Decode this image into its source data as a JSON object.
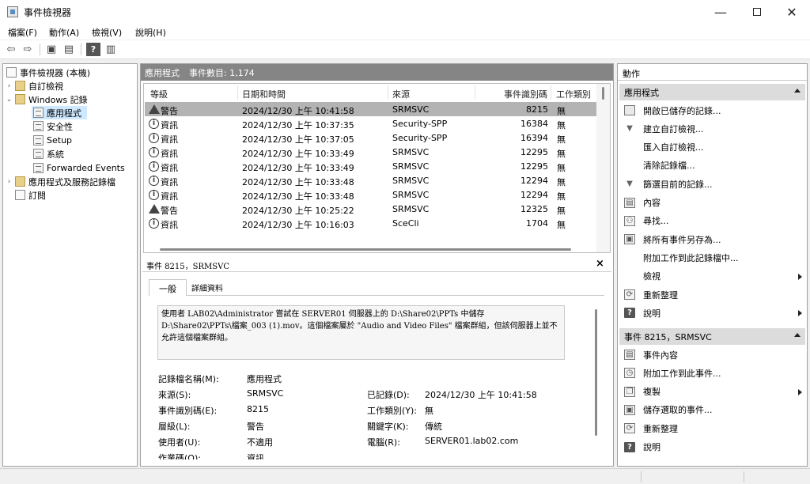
{
  "window": {
    "title": "事件檢視器"
  },
  "menu": [
    "檔案(F)",
    "動作(A)",
    "檢視(V)",
    "說明(H)"
  ],
  "tree": {
    "items": [
      {
        "label": "事件檢視器 (本機)",
        "icon": "event-viewer-icon"
      },
      {
        "label": "自訂檢視",
        "icon": "folder-icon"
      },
      {
        "label": "Windows 記錄",
        "icon": "folder-icon"
      },
      {
        "label": "應用程式",
        "icon": "log-icon"
      },
      {
        "label": "安全性",
        "icon": "log-icon"
      },
      {
        "label": "Setup",
        "icon": "log-icon"
      },
      {
        "label": "系統",
        "icon": "log-icon"
      },
      {
        "label": "Forwarded Events",
        "icon": "log-icon"
      },
      {
        "label": "應用程式及服務記錄檔",
        "icon": "folder-icon"
      },
      {
        "label": "訂閱",
        "icon": "subscription-icon"
      }
    ]
  },
  "list": {
    "title": "應用程式",
    "count_label": "事件數目: 1,174",
    "columns": [
      "等級",
      "日期和時間",
      "來源",
      "事件識別碼",
      "工作類別"
    ],
    "rows": [
      {
        "level": "警告",
        "icon": "warning-icon",
        "datetime": "2024/12/30 上午 10:41:58",
        "source": "SRMSVC",
        "id": "8215",
        "task": "無"
      },
      {
        "level": "資訊",
        "icon": "info-icon",
        "datetime": "2024/12/30 上午 10:37:35",
        "source": "Security-SPP",
        "id": "16384",
        "task": "無"
      },
      {
        "level": "資訊",
        "icon": "info-icon",
        "datetime": "2024/12/30 上午 10:37:05",
        "source": "Security-SPP",
        "id": "16394",
        "task": "無"
      },
      {
        "level": "資訊",
        "icon": "info-icon",
        "datetime": "2024/12/30 上午 10:33:49",
        "source": "SRMSVC",
        "id": "12295",
        "task": "無"
      },
      {
        "level": "資訊",
        "icon": "info-icon",
        "datetime": "2024/12/30 上午 10:33:49",
        "source": "SRMSVC",
        "id": "12295",
        "task": "無"
      },
      {
        "level": "資訊",
        "icon": "info-icon",
        "datetime": "2024/12/30 上午 10:33:48",
        "source": "SRMSVC",
        "id": "12294",
        "task": "無"
      },
      {
        "level": "資訊",
        "icon": "info-icon",
        "datetime": "2024/12/30 上午 10:33:48",
        "source": "SRMSVC",
        "id": "12294",
        "task": "無"
      },
      {
        "level": "警告",
        "icon": "warning-icon",
        "datetime": "2024/12/30 上午 10:25:22",
        "source": "SRMSVC",
        "id": "12325",
        "task": "無"
      },
      {
        "level": "資訊",
        "icon": "info-icon",
        "datetime": "2024/12/30 上午 10:16:03",
        "source": "SceCli",
        "id": "1704",
        "task": "無"
      }
    ]
  },
  "detail": {
    "title": "事件 8215，SRMSVC",
    "close": "×",
    "tabs": [
      "一般",
      "詳細資料"
    ],
    "message": "使用者 LAB02\\Administrator 嘗試在 SERVER01 伺服器上的 D:\\Share02\\PPTs 中儲存 D:\\Share02\\PPTs\\檔案_003 (1).mov。這個檔案屬於 \"Audio and Video Files\" 檔案群組，但該伺服器上並不允許這個檔案群組。",
    "labels": {
      "log_name": "記錄檔名稱(M):",
      "source": "來源(S):",
      "event_id": "事件識別碼(E):",
      "level": "層級(L):",
      "user": "使用者(U):",
      "opcode": "作業碼(O):",
      "logged": "已記錄(D):",
      "task": "工作類別(Y):",
      "keywords": "關鍵字(K):",
      "computer": "電腦(R):"
    },
    "values": {
      "log_name": "應用程式",
      "source": "SRMSVC",
      "event_id": "8215",
      "level": "警告",
      "user": "不適用",
      "opcode": "資訊",
      "logged": "2024/12/30 上午 10:41:58",
      "task": "無",
      "keywords": "傳統",
      "computer": "SERVER01.lab02.com"
    }
  },
  "actions": {
    "title": "動作",
    "section1": "應用程式",
    "items1": [
      {
        "label": "開啟已儲存的記錄...",
        "icon": "open-folder-icon"
      },
      {
        "label": "建立自訂檢視...",
        "icon": "filter-icon"
      },
      {
        "label": "匯入自訂檢視...",
        "icon": ""
      },
      {
        "label": "清除記錄檔...",
        "icon": ""
      },
      {
        "label": "篩選目前的記錄...",
        "icon": "filter-icon"
      },
      {
        "label": "內容",
        "icon": "properties-icon"
      },
      {
        "label": "尋找...",
        "icon": "binoculars-icon"
      },
      {
        "label": "將所有事件另存為...",
        "icon": "save-icon"
      },
      {
        "label": "附加工作到此記錄檔中...",
        "icon": ""
      },
      {
        "label": "檢視",
        "icon": "",
        "submenu": true
      },
      {
        "label": "重新整理",
        "icon": "refresh-icon"
      },
      {
        "label": "說明",
        "icon": "help-icon",
        "submenu": true
      }
    ],
    "section2": "事件 8215，SRMSVC",
    "items2": [
      {
        "label": "事件內容",
        "icon": "properties-icon"
      },
      {
        "label": "附加工作到此事件...",
        "icon": "task-icon"
      },
      {
        "label": "複製",
        "icon": "copy-icon",
        "submenu": true
      },
      {
        "label": "儲存選取的事件...",
        "icon": "save-icon"
      },
      {
        "label": "重新整理",
        "icon": "refresh-icon"
      },
      {
        "label": "說明",
        "icon": "help-icon"
      }
    ]
  }
}
